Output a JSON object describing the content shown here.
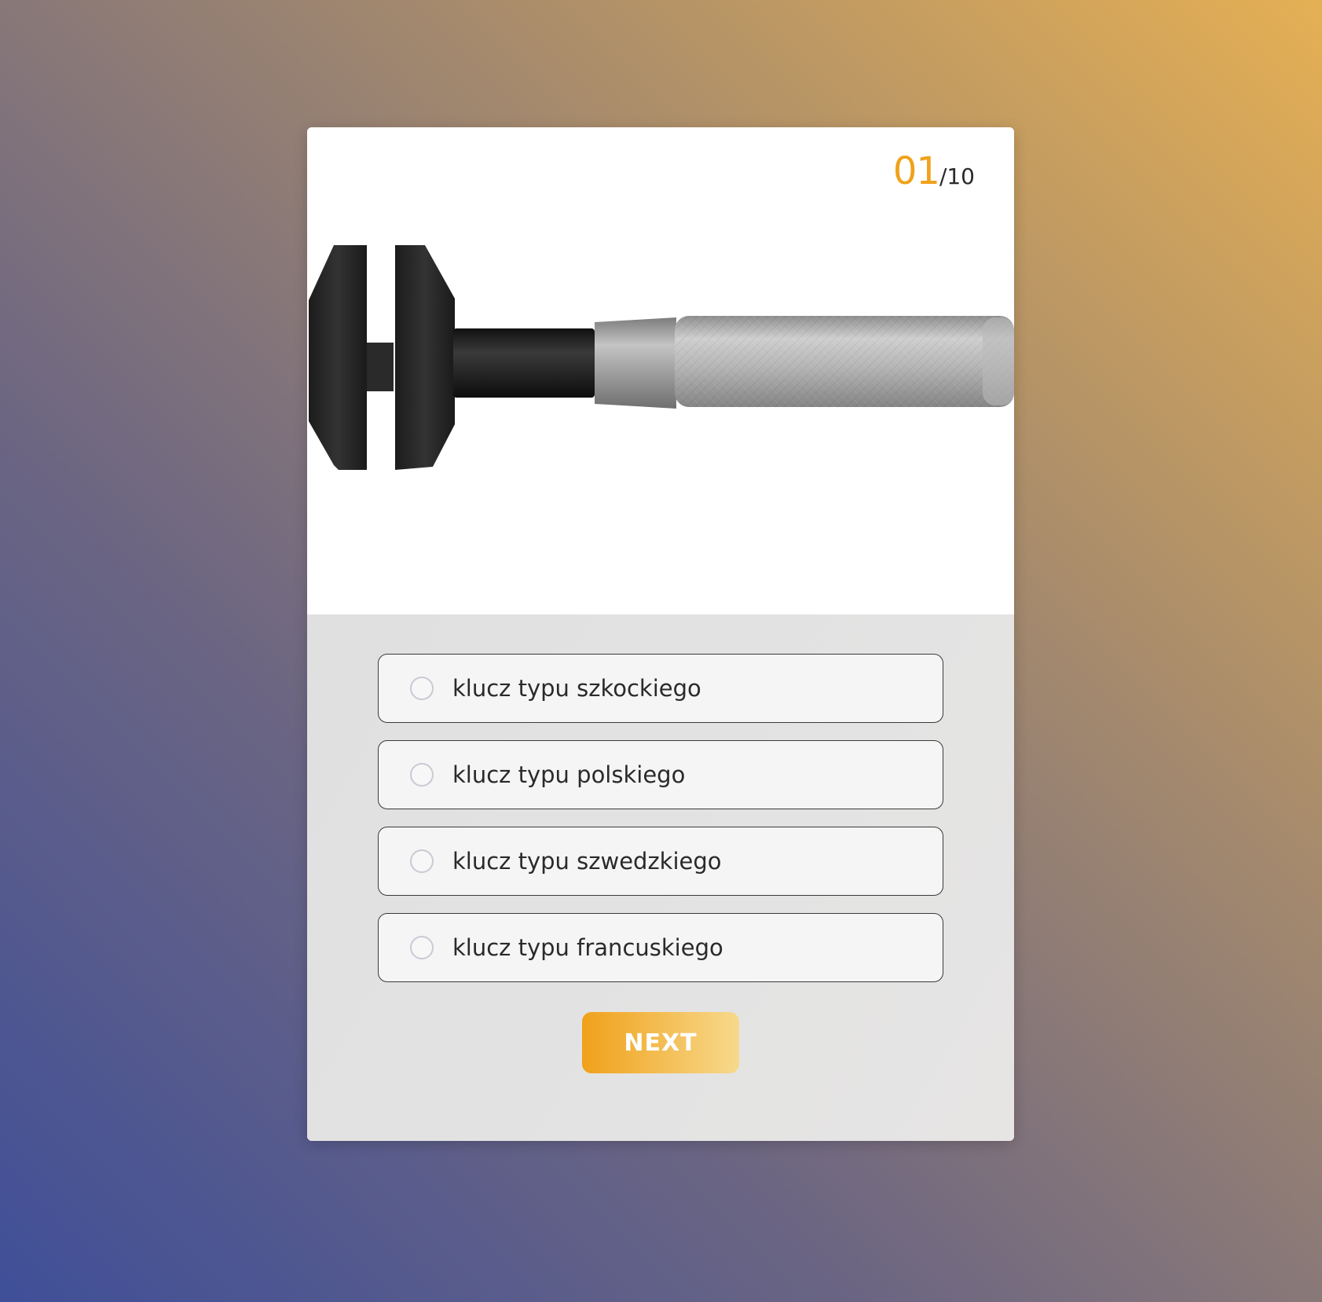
{
  "quiz": {
    "counter": {
      "current": "01",
      "total": "/10"
    },
    "image": {
      "subject": "wrench-image"
    },
    "options": [
      {
        "label": "klucz typu szkockiego"
      },
      {
        "label": "klucz typu polskiego"
      },
      {
        "label": "klucz typu szwedzkiego"
      },
      {
        "label": "klucz typu francuskiego"
      }
    ],
    "next_label": "NEXT"
  },
  "colors": {
    "accent": "#f0a21b",
    "button_gradient_start": "#f0a11a",
    "button_gradient_end": "#f7d98c",
    "card_top": "#ffffff",
    "card_bottom": "#e3e2e1"
  }
}
